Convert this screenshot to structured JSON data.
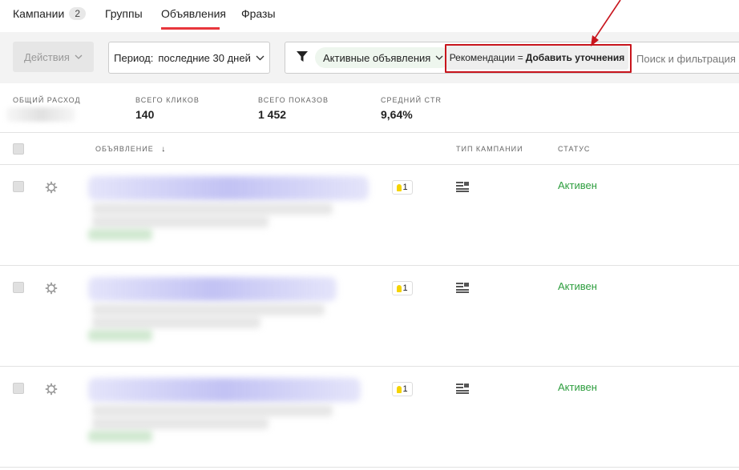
{
  "tabs": [
    {
      "label": "Кампании",
      "count": "2"
    },
    {
      "label": "Группы"
    },
    {
      "label": "Объявления"
    },
    {
      "label": "Фразы"
    }
  ],
  "toolbar": {
    "actions_label": "Действия",
    "period_label": "Период:",
    "period_value": "последние 30 дней",
    "filter_active_label": "Активные объявления",
    "reco_prefix": "Рекомендации =",
    "reco_value": "Добавить уточнения",
    "search_placeholder": "Поиск и фильтрация по"
  },
  "stats": {
    "spend_label": "Общий расход",
    "clicks_label": "Всего кликов",
    "clicks_value": "140",
    "shows_label": "Всего показов",
    "shows_value": "1 452",
    "ctr_label": "Средний CTR",
    "ctr_value": "9,64%"
  },
  "table": {
    "col_ad": "Объявление",
    "col_ad_sort": "↓",
    "col_type": "Тип кампании",
    "col_status": "Статус",
    "rows": [
      {
        "reco_count": "1",
        "status": "Активен"
      },
      {
        "reco_count": "1",
        "status": "Активен"
      },
      {
        "reco_count": "1",
        "status": "Активен"
      }
    ]
  },
  "colors": {
    "accent": "#e8363c",
    "status_active": "#2e9e3f",
    "highlight": "#c8151d"
  }
}
